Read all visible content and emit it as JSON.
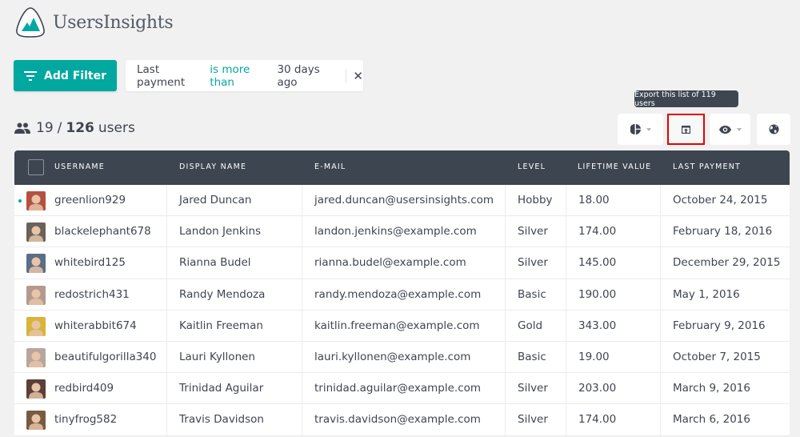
{
  "app": {
    "name": "UsersInsights",
    "brand_color": "#00a8a0"
  },
  "toolbar": {
    "add_filter_label": "Add Filter",
    "filter": {
      "field": "Last payment",
      "operator": "is more than",
      "value": "30 days ago"
    },
    "user_count": {
      "shown": "19",
      "separator": "/",
      "total": "126",
      "label": "users"
    },
    "tooltip": "Export this list of 119 users",
    "buttons": [
      {
        "icon": "segment-chart-icon",
        "has_dropdown": true
      },
      {
        "icon": "export-icon",
        "has_dropdown": false,
        "highlighted": true
      },
      {
        "icon": "eye-icon",
        "has_dropdown": true
      },
      {
        "icon": "globe-icon",
        "has_dropdown": false
      }
    ]
  },
  "table": {
    "columns": [
      "USERNAME",
      "DISPLAY NAME",
      "E-MAIL",
      "LEVEL",
      "LIFETIME VALUE",
      "LAST PAYMENT"
    ],
    "rows": [
      {
        "username": "greenlion929",
        "display": "Jared Duncan",
        "email": "jared.duncan@usersinsights.com",
        "level": "Hobby",
        "ltv": "18.00",
        "last_payment": "October 24, 2015",
        "online": true,
        "avatar_color": "#b5513f"
      },
      {
        "username": "blackelephant678",
        "display": "Landon Jenkins",
        "email": "landon.jenkins@example.com",
        "level": "Silver",
        "ltv": "174.00",
        "last_payment": "February 18, 2016",
        "online": false,
        "avatar_color": "#6b6259"
      },
      {
        "username": "whitebird125",
        "display": "Rianna Budel",
        "email": "rianna.budel@example.com",
        "level": "Silver",
        "ltv": "145.00",
        "last_payment": "December 29, 2015",
        "online": false,
        "avatar_color": "#5c6d86"
      },
      {
        "username": "redostrich431",
        "display": "Randy Mendoza",
        "email": "randy.mendoza@example.com",
        "level": "Basic",
        "ltv": "190.00",
        "last_payment": "May 1, 2016",
        "online": false,
        "avatar_color": "#b49a8e"
      },
      {
        "username": "whiterabbit674",
        "display": "Kaitlin Freeman",
        "email": "kaitlin.freeman@example.com",
        "level": "Gold",
        "ltv": "343.00",
        "last_payment": "February 9, 2016",
        "online": false,
        "avatar_color": "#d9b43a"
      },
      {
        "username": "beautifulgorilla340",
        "display": "Lauri Kyllonen",
        "email": "lauri.kyllonen@example.com",
        "level": "Basic",
        "ltv": "19.00",
        "last_payment": "October 7, 2015",
        "online": false,
        "avatar_color": "#b8a59c"
      },
      {
        "username": "redbird409",
        "display": "Trinidad Aguilar",
        "email": "trinidad.aguilar@example.com",
        "level": "Silver",
        "ltv": "203.00",
        "last_payment": "March 9, 2016",
        "online": false,
        "avatar_color": "#5a4038"
      },
      {
        "username": "tinyfrog582",
        "display": "Travis Davidson",
        "email": "travis.davidson@example.com",
        "level": "Silver",
        "ltv": "174.00",
        "last_payment": "March 6, 2016",
        "online": false,
        "avatar_color": "#7a5a3e"
      }
    ]
  }
}
